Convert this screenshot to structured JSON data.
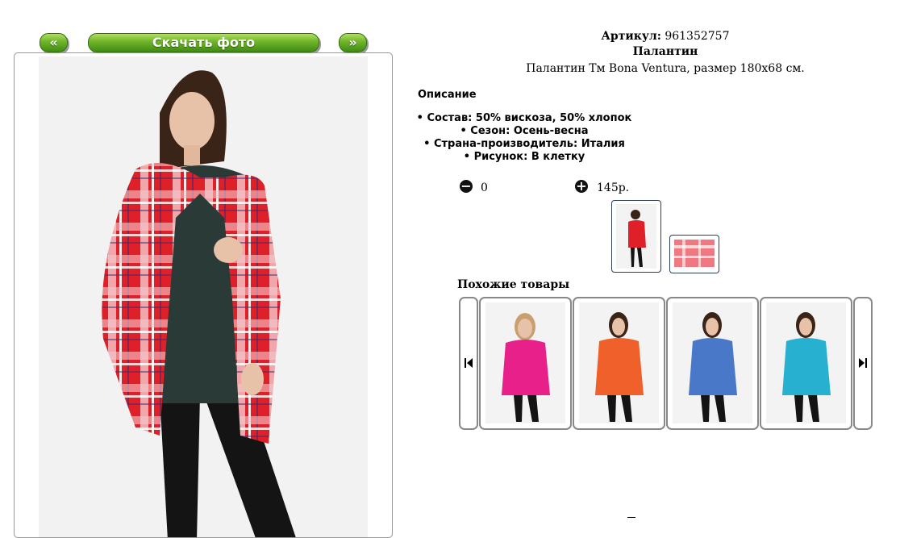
{
  "nav": {
    "prev_label": "«",
    "download_label": "Скачать фото",
    "next_label": "»"
  },
  "product": {
    "sku_label": "Артикул:",
    "sku_value": "961352757",
    "name": "Палантин",
    "subtitle": "Палантин Тм Bona Ventura, размер 180х68 см."
  },
  "description": {
    "title": "Описание",
    "properties": [
      "Состав: 50% вискоза, 50% хлопок",
      "Сезон: Осень-весна",
      "Страна-производитель: Италия",
      "Рисунок: В клетку"
    ]
  },
  "order": {
    "minus_icon": "minus-circle-icon",
    "quantity": "0",
    "plus_icon": "plus-circle-icon",
    "price": "145р."
  },
  "similar": {
    "title": "Похожие товары",
    "prev_icon": "skip-previous-icon",
    "next_icon": "skip-next-icon",
    "items": [
      {
        "color": "#e8208a"
      },
      {
        "color": "#f0602a"
      },
      {
        "color": "#4a78c8"
      },
      {
        "color": "#28b0d0"
      }
    ]
  },
  "colors": {
    "button_green": "#6fb32a",
    "scarf_red": "#e02028"
  }
}
